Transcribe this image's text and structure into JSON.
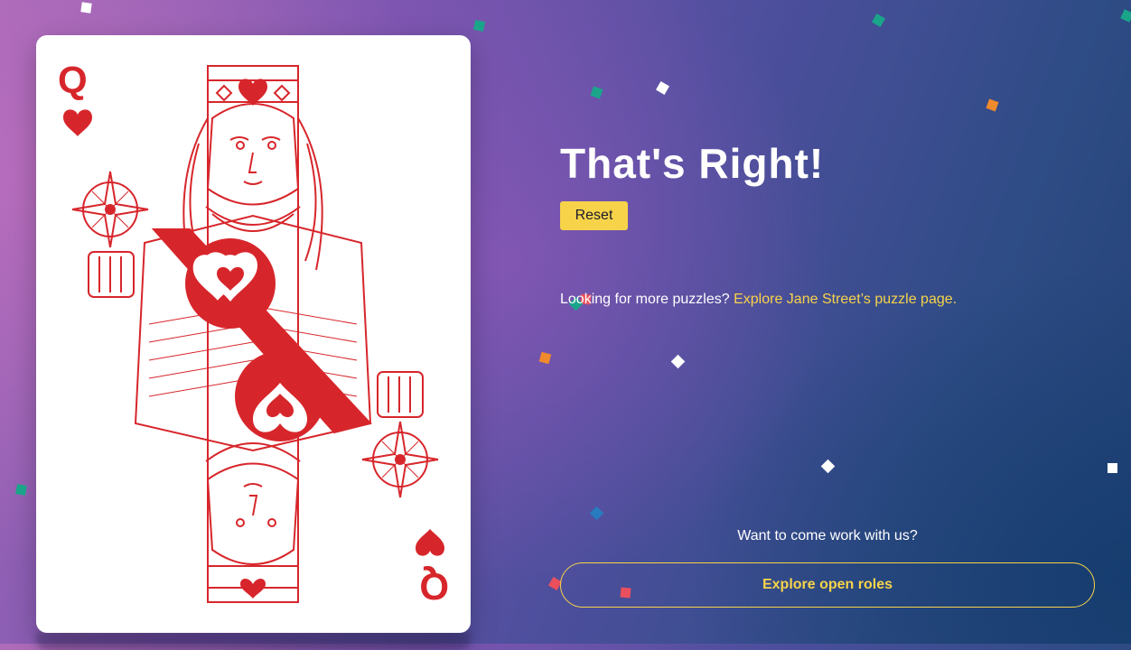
{
  "result": {
    "title": "That's Right!",
    "reset_label": "Reset"
  },
  "puzzles": {
    "prompt": "Looking for more puzzles?",
    "link_label": "Explore Jane Street’s puzzle page."
  },
  "careers": {
    "prompt": "Want to come work with us?",
    "button_label": "Explore open roles"
  },
  "card": {
    "rank": "Q",
    "suit": "hearts",
    "color": "#d7262b"
  },
  "colors": {
    "accent": "#f7d34a",
    "confetti_green": "#1aa58a",
    "confetti_orange": "#f08a2c",
    "confetti_red": "#e94f5c",
    "confetti_blue": "#2a7ac0",
    "confetti_white": "#ffffff"
  }
}
